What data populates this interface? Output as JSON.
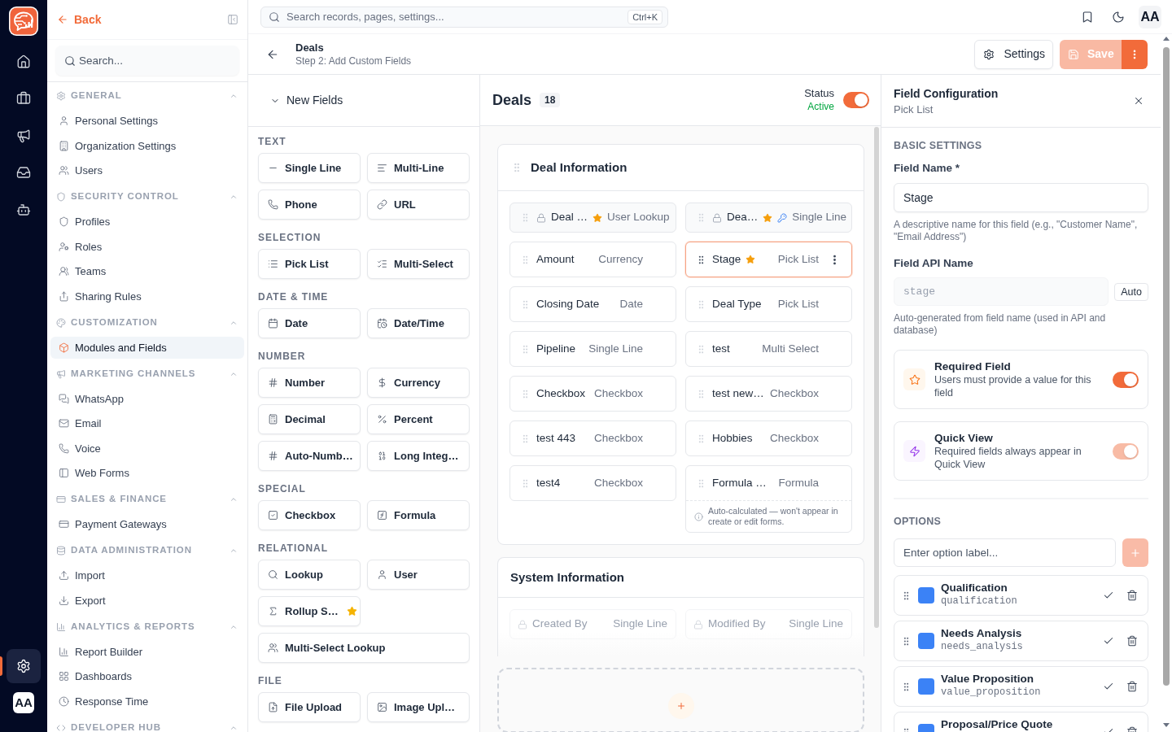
{
  "rail": {
    "items": [
      {
        "selected": false
      },
      {
        "selected": false
      },
      {
        "selected": false
      },
      {
        "selected": false
      },
      {
        "selected": false
      }
    ],
    "settings": {
      "selected": true
    },
    "avatar": "AA"
  },
  "sidebar": {
    "back": "Back",
    "search": {
      "placeholder": "Search..."
    },
    "sections": [
      {
        "title": "GENERAL",
        "expanded": true,
        "items": [
          {
            "label": "Personal Settings",
            "selected": false
          },
          {
            "label": "Organization Settings",
            "selected": false
          },
          {
            "label": "Users",
            "selected": false
          }
        ]
      },
      {
        "title": "SECURITY CONTROL",
        "expanded": true,
        "items": [
          {
            "label": "Profiles",
            "selected": false
          },
          {
            "label": "Roles",
            "selected": false
          },
          {
            "label": "Teams",
            "selected": false
          },
          {
            "label": "Sharing Rules",
            "selected": false
          }
        ]
      },
      {
        "title": "CUSTOMIZATION",
        "expanded": true,
        "items": [
          {
            "label": "Modules and Fields",
            "selected": true
          }
        ]
      },
      {
        "title": "MARKETING CHANNELS",
        "expanded": true,
        "items": [
          {
            "label": "WhatsApp",
            "selected": false
          },
          {
            "label": "Email",
            "selected": false
          },
          {
            "label": "Voice",
            "selected": false
          },
          {
            "label": "Web Forms",
            "selected": false
          }
        ]
      },
      {
        "title": "SALES & FINANCE",
        "expanded": true,
        "items": [
          {
            "label": "Payment Gateways",
            "selected": false
          }
        ]
      },
      {
        "title": "DATA ADMINISTRATION",
        "expanded": true,
        "items": [
          {
            "label": "Import",
            "selected": false
          },
          {
            "label": "Export",
            "selected": false
          }
        ]
      },
      {
        "title": "ANALYTICS & REPORTS",
        "expanded": true,
        "items": [
          {
            "label": "Report Builder",
            "selected": false
          },
          {
            "label": "Dashboards",
            "selected": false
          },
          {
            "label": "Response Time",
            "selected": false
          }
        ]
      },
      {
        "title": "DEVELOPER HUB",
        "expanded": true
      }
    ]
  },
  "topbar": {
    "search": {
      "placeholder": "Search records, pages, settings...",
      "shortcut": "Ctrl+K"
    },
    "avatar": "AA"
  },
  "page_header": {
    "title": "Deals",
    "subtitle": "Step 2: Add Custom Fields",
    "settings": "Settings",
    "save": {
      "label": "Save",
      "disabled": true
    }
  },
  "palette": {
    "title": "New Fields",
    "expanded": true,
    "groups": [
      {
        "title": "TEXT",
        "items": [
          {
            "label": "Single Line",
            "starred": false,
            "wide": false
          },
          {
            "label": "Multi-Line",
            "starred": false,
            "wide": false
          },
          {
            "label": "Phone",
            "starred": false,
            "wide": false
          },
          {
            "label": "URL",
            "starred": false,
            "wide": false
          }
        ]
      },
      {
        "title": "SELECTION",
        "items": [
          {
            "label": "Pick List",
            "starred": false,
            "wide": false
          },
          {
            "label": "Multi-Select",
            "starred": false,
            "wide": false
          }
        ]
      },
      {
        "title": "DATE & TIME",
        "items": [
          {
            "label": "Date",
            "starred": false,
            "wide": false
          },
          {
            "label": "Date/Time",
            "starred": false,
            "wide": false
          }
        ]
      },
      {
        "title": "NUMBER",
        "items": [
          {
            "label": "Number",
            "starred": false,
            "wide": false
          },
          {
            "label": "Currency",
            "starred": false,
            "wide": false
          },
          {
            "label": "Decimal",
            "starred": false,
            "wide": false
          },
          {
            "label": "Percent",
            "starred": false,
            "wide": false
          },
          {
            "label": "Auto-Numb…",
            "starred": false,
            "wide": false
          },
          {
            "label": "Long Integ…",
            "starred": false,
            "wide": false
          }
        ]
      },
      {
        "title": "SPECIAL",
        "items": [
          {
            "label": "Checkbox",
            "starred": false,
            "wide": false
          },
          {
            "label": "Formula",
            "starred": false,
            "wide": false
          }
        ]
      },
      {
        "title": "RELATIONAL",
        "items": [
          {
            "label": "Lookup",
            "starred": false,
            "wide": false
          },
          {
            "label": "User",
            "starred": false,
            "wide": false
          },
          {
            "label": "Rollup S…",
            "starred": true,
            "wide": false
          },
          {
            "label": "Multi-Select Lookup",
            "starred": false,
            "wide": true
          }
        ]
      },
      {
        "title": "FILE",
        "items": [
          {
            "label": "File Upload",
            "starred": false,
            "wide": false
          },
          {
            "label": "Image Upl…",
            "starred": false,
            "wide": false
          }
        ]
      }
    ]
  },
  "module": {
    "title": "Deals",
    "count": "18",
    "status": {
      "label": "Status",
      "value": "Active",
      "on": true
    },
    "sections": [
      {
        "title": "Deal Information",
        "draggable": true,
        "fields": [
          {
            "name": "Deal …",
            "type": "User Lookup",
            "locked": true,
            "required": true,
            "key": false,
            "selected": false,
            "disabled": false
          },
          {
            "name": "Dea…",
            "type": "Single Line",
            "locked": true,
            "required": true,
            "key": true,
            "selected": false,
            "disabled": false
          },
          {
            "name": "Amount",
            "type": "Currency",
            "locked": false,
            "required": false,
            "key": false,
            "selected": false,
            "disabled": false
          },
          {
            "name": "Stage",
            "type": "Pick List",
            "locked": false,
            "required": true,
            "key": false,
            "selected": true,
            "disabled": false
          },
          {
            "name": "Closing Date",
            "type": "Date",
            "locked": false,
            "required": false,
            "key": false,
            "selected": false,
            "disabled": false
          },
          {
            "name": "Deal Type",
            "type": "Pick List",
            "locked": false,
            "required": false,
            "key": false,
            "selected": false,
            "disabled": false
          },
          {
            "name": "Pipeline",
            "type": "Single Line",
            "locked": false,
            "required": false,
            "key": false,
            "selected": false,
            "disabled": false
          },
          {
            "name": "test",
            "type": "Multi Select",
            "locked": false,
            "required": false,
            "key": false,
            "selected": false,
            "disabled": false
          },
          {
            "name": "Checkbox",
            "type": "Checkbox",
            "locked": false,
            "required": false,
            "key": false,
            "selected": false,
            "disabled": false
          },
          {
            "name": "test new…",
            "type": "Checkbox",
            "locked": false,
            "required": false,
            "key": false,
            "selected": false,
            "disabled": false
          },
          {
            "name": "test 443",
            "type": "Checkbox",
            "locked": false,
            "required": false,
            "key": false,
            "selected": false,
            "disabled": false
          },
          {
            "name": "Hobbies",
            "type": "Checkbox",
            "locked": false,
            "required": false,
            "key": false,
            "selected": false,
            "disabled": false
          },
          {
            "name": "test4",
            "type": "Checkbox",
            "locked": false,
            "required": false,
            "key": false,
            "selected": false,
            "disabled": false
          },
          {
            "name": "Formula …",
            "type": "Formula",
            "locked": false,
            "required": false,
            "key": false,
            "selected": false,
            "disabled": false,
            "note": "Auto-calculated — won't appear in create or edit forms."
          }
        ]
      },
      {
        "title": "System Information",
        "draggable": false,
        "fields": [
          {
            "name": "Created By",
            "type": "Single Line",
            "locked": true,
            "required": false,
            "key": false,
            "selected": false,
            "disabled": true
          },
          {
            "name": "Modified By",
            "type": "Single Line",
            "locked": true,
            "required": false,
            "key": false,
            "selected": false,
            "disabled": true
          }
        ]
      }
    ]
  },
  "config": {
    "title": "Field Configuration",
    "subtitle": "Pick List",
    "basic_settings": {
      "heading": "BASIC SETTINGS",
      "field_name": {
        "label": "Field Name *",
        "value": "Stage",
        "help": "A descriptive name for this field (e.g., \"Customer Name\", \"Email Address\")"
      },
      "api_name": {
        "label": "Field API Name",
        "value": "stage",
        "disabled": true,
        "badge": "Auto",
        "help": "Auto-generated from field name (used in API and database)"
      }
    },
    "toggles": [
      {
        "title": "Required Field",
        "description": "Users must provide a value for this field",
        "on": true,
        "disabled": false
      },
      {
        "title": "Quick View",
        "description": "Required fields always appear in Quick View",
        "on": true,
        "disabled": true
      }
    ],
    "options": {
      "heading": "OPTIONS",
      "input": {
        "placeholder": "Enter option label..."
      },
      "add_button": {
        "disabled": true
      },
      "items": [
        {
          "label": "Qualification",
          "value": "qualification",
          "color": "#3b82f6"
        },
        {
          "label": "Needs Analysis",
          "value": "needs_analysis",
          "color": "#3b82f6"
        },
        {
          "label": "Value Proposition",
          "value": "value_proposition",
          "color": "#3b82f6"
        },
        {
          "label": "Proposal/Price Quote",
          "color": "#3b82f6"
        }
      ]
    }
  }
}
